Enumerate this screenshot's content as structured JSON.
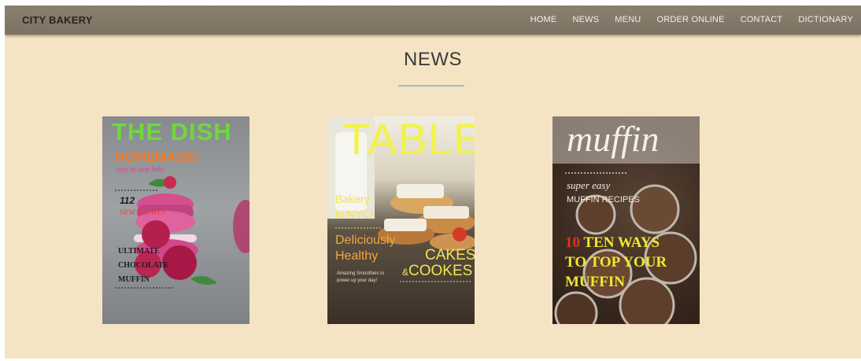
{
  "navbar": {
    "brand": "CITY BAKERY",
    "links": [
      "HOME",
      "NEWS",
      "MENU",
      "ORDER ONLINE",
      "CONTACT",
      "DICTIONARY"
    ]
  },
  "section": {
    "title": "NEWS"
  },
  "covers": [
    {
      "title": "THE DISH",
      "subtitle": "HOMEMADE!",
      "tagline": "step by step bake",
      "number": "112",
      "recipes": "NEW RECIPES",
      "line1": "ULTIMATE",
      "line2": "CHOCOLATE",
      "line3": "MUFFIN"
    },
    {
      "title": "TABLE",
      "bakery1": "Bakery",
      "bakery2": "in NYC!",
      "deliciously": "Deliciously",
      "healthy": "Healthy",
      "small1": "Amazing Smoothies to",
      "small2": "power up your day!",
      "cakes": "CAKES",
      "amp": "&",
      "cookes": "COOKES"
    },
    {
      "title": "muffin",
      "super": "super easy",
      "recipes": "MUFFIN RECIPES",
      "num": "10",
      "line1": "TEN WAYS",
      "line2": "TO TOP YOUR",
      "line3": "MUFFIN"
    }
  ],
  "colors": {
    "background": "#f5e4c3",
    "navbar": "#857a6b",
    "accent_rule": "#8fc3cc"
  }
}
